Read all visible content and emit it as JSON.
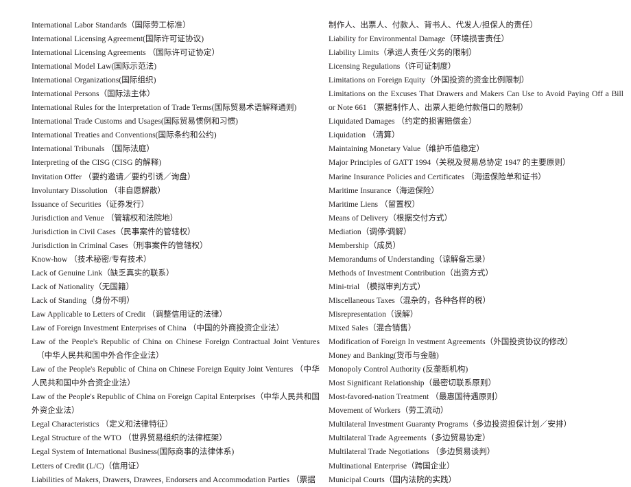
{
  "document": {
    "type": "bilingual-glossary-index",
    "page_background": "#ffffff",
    "text_color": "#231f20",
    "columns": 2
  },
  "left_column": {
    "entries": [
      {
        "id": "international-labor-standards",
        "text": "International Labor Standards（国际劳工标准）",
        "wrapped": false
      },
      {
        "id": "international-licensing-agreement",
        "text": "International Licensing Agreement(国际许可证协议)",
        "wrapped": false
      },
      {
        "id": "international-licensing-agreements",
        "text": "International Licensing Agreements  （国际许可证协定）",
        "wrapped": false
      },
      {
        "id": "international-model-law",
        "text": "International Model Law(国际示范法)",
        "wrapped": false
      },
      {
        "id": "international-organizations",
        "text": "International Organizations(国际组织)",
        "wrapped": false
      },
      {
        "id": "international-persons",
        "text": "International Persons（国际法主体）",
        "wrapped": false
      },
      {
        "id": "international-rules-interpretation-trade-terms",
        "text": "International Rules for the Interpretation of Trade Terms(国际贸易术语解释通则)",
        "wrapped": false
      },
      {
        "id": "international-trade-customs-and-usages",
        "text": "International Trade Customs and Usages(国际贸易惯例和习惯)",
        "wrapped": false
      },
      {
        "id": "international-treaties-and-conventions",
        "text": "International Treaties and Conventions(国际条约和公约)",
        "wrapped": false
      },
      {
        "id": "international-tribunals",
        "text": "International Tribunals  （国际法庭）",
        "wrapped": false
      },
      {
        "id": "interpreting-of-the-cisg",
        "text": "Interpreting of the CISG (CISG 的解释)",
        "wrapped": false
      },
      {
        "id": "invitation-offer",
        "text": "Invitation Offer  （要约邀请／要约引诱／询盘）",
        "wrapped": false
      },
      {
        "id": "involuntary-dissolution",
        "text": "Involuntary Dissolution  （非自愿解散）",
        "wrapped": false
      },
      {
        "id": "issuance-of-securities",
        "text": "Issuance of Securities（证券发行）",
        "wrapped": false
      },
      {
        "id": "jurisdiction-and-venue",
        "text": "Jurisdiction and Venue  （管辖权和法院地）",
        "wrapped": false
      },
      {
        "id": "jurisdiction-in-civil-cases",
        "text": "Jurisdiction in Civil Cases（民事案件的管辖权）",
        "wrapped": false
      },
      {
        "id": "jurisdiction-in-criminal-cases",
        "text": "Jurisdiction in Criminal Cases（刑事案件的管辖权）",
        "wrapped": false
      },
      {
        "id": "know-how",
        "text": "Know-how  （技术秘密/专有技术）",
        "wrapped": false
      },
      {
        "id": "lack-of-genuine-link",
        "text": "Lack of Genuine Link（缺乏真实的联系）",
        "wrapped": false
      },
      {
        "id": "lack-of-nationality",
        "text": "Lack of Nationality（无国籍）",
        "wrapped": false
      },
      {
        "id": "lack-of-standing",
        "text": "Lack of Standing（身份不明）",
        "wrapped": false
      },
      {
        "id": "law-applicable-to-letters-of-credit",
        "text": "Law Applicable to Letters of Credit  （调整信用证的法律）",
        "wrapped": false
      },
      {
        "id": "law-of-foreign-investment-enterprises-of-china",
        "text": "Law of Foreign Investment Enterprises of China  （中国的外商投资企业法）",
        "wrapped": false
      },
      {
        "id": "prc-chinese-foreign-contractual-joint-ventures",
        "text": "Law of the People's Republic of China on Chinese Foreign Contractual Joint Ventures （中华人民共和国中外合作企业法）",
        "wrapped": true,
        "hang": true
      },
      {
        "id": "prc-chinese-foreign-equity-joint-ventures",
        "text": "Law of the People's Republic of China on Chinese Foreign Equity Joint Ventures  （中华人民共和国中外合资企业法）",
        "wrapped": true,
        "hang": false
      },
      {
        "id": "prc-foreign-capital-enterprises",
        "text": "Law of the People's Republic of China on Foreign Capital Enterprises（中华人民共和国外资企业法）",
        "wrapped": true,
        "hang": false
      },
      {
        "id": "legal-characteristics",
        "text": "Legal Characteristics  （定义和法律特征）",
        "wrapped": false
      },
      {
        "id": "legal-structure-of-the-wto",
        "text": "Legal Structure of the WTO  （世界贸易组织的法律框架）",
        "wrapped": false
      },
      {
        "id": "legal-system-of-international-business",
        "text": "Legal System of International Business(国际商事的法律体系)",
        "wrapped": false
      },
      {
        "id": "letters-of-credit",
        "text": "Letters of Credit (L/C)（信用证）",
        "wrapped": false
      },
      {
        "id": "liabilities-of-makers-drawers-drawees",
        "text": "Liabilities of Makers, Drawers, Drawees, Endorsers and Accommodation Parties （票据",
        "wrapped": false,
        "continues_in_right_column": true
      }
    ]
  },
  "right_column": {
    "entries": [
      {
        "id": "liabilities-continuation",
        "text": "制作人、出票人、付款人、背书人、代发人/担保人的责任）",
        "is_continuation": true
      },
      {
        "id": "liability-for-environmental-damage",
        "text": "Liability for Environmental Damage（环境损害责任）",
        "wrapped": false
      },
      {
        "id": "liability-limits",
        "text": "Liability Limits（承运人责任/义务的限制）",
        "wrapped": false
      },
      {
        "id": "licensing-regulations",
        "text": "Licensing Regulations（许可证制度）",
        "wrapped": false
      },
      {
        "id": "limitations-on-foreign-equity",
        "text": "Limitations on Foreign Equity（外国投资的资金比例限制）",
        "wrapped": false
      },
      {
        "id": "limitations-on-the-excuses",
        "text": "Limitations on the Excuses That Drawers and Makers Can Use to Avoid Paying Off a Bill or Note  661  （票据制作人、出票人拒绝付款借口的限制）",
        "wrapped": true,
        "page_number": "661"
      },
      {
        "id": "liquidated-damages",
        "text": "Liquidated Damages  （约定的损害赔偿金）",
        "wrapped": false
      },
      {
        "id": "liquidation",
        "text": "Liquidation  （清算）",
        "wrapped": false
      },
      {
        "id": "maintaining-monetary-value",
        "text": "Maintaining Monetary Value（维护币值稳定）",
        "wrapped": false
      },
      {
        "id": "major-principles-of-gatt-1994",
        "text": "Major Principles of GATT 1994（关税及贸易总协定 1947 的主要原则）",
        "wrapped": false
      },
      {
        "id": "marine-insurance-policies-and-certificates",
        "text": "Marine Insurance Policies and Certificates  （海运保险单和证书）",
        "wrapped": false
      },
      {
        "id": "maritime-insurance",
        "text": "Maritime Insurance（海运保险）",
        "wrapped": false
      },
      {
        "id": "maritime-liens",
        "text": "Maritime Liens  （留置权）",
        "wrapped": false
      },
      {
        "id": "means-of-delivery",
        "text": "Means of Delivery（根据交付方式）",
        "wrapped": false
      },
      {
        "id": "mediation",
        "text": "Mediation（调停/调解）",
        "wrapped": false
      },
      {
        "id": "membership",
        "text": "Membership（成员）",
        "wrapped": false
      },
      {
        "id": "memorandums-of-understanding",
        "text": "Memorandums of Understanding（谅解备忘录）",
        "wrapped": false
      },
      {
        "id": "methods-of-investment-contribution",
        "text": "Methods of Investment Contribution（出资方式）",
        "wrapped": false
      },
      {
        "id": "mini-trial",
        "text": "Mini-trial  （模拟审判方式）",
        "wrapped": false
      },
      {
        "id": "miscellaneous-taxes",
        "text": "Miscellaneous Taxes（混杂的，各种各样的税）",
        "wrapped": false
      },
      {
        "id": "misrepresentation",
        "text": "Misrepresentation（误解）",
        "wrapped": false
      },
      {
        "id": "mixed-sales",
        "text": "Mixed Sales（混合销售）",
        "wrapped": false
      },
      {
        "id": "modification-of-foreign-investment-agreements",
        "text": "Modification of Foreign In vestment Agreements（外国投资协议的修改）",
        "wrapped": false
      },
      {
        "id": "money-and-banking",
        "text": "Money and Banking(货币与金融)",
        "wrapped": false
      },
      {
        "id": "monopoly-control-authority",
        "text": "Monopoly Control Authority (反垄断机构)",
        "wrapped": false
      },
      {
        "id": "most-significant-relationship",
        "text": "Most Significant Relationship（最密切联系原则）",
        "wrapped": false
      },
      {
        "id": "most-favored-nation-treatment",
        "text": "Most-favored-nation Treatment  （最惠国待遇原则）",
        "wrapped": false
      },
      {
        "id": "movement-of-workers",
        "text": "Movement of Workers（劳工流动）",
        "wrapped": false
      },
      {
        "id": "multilateral-investment-guaranty-programs",
        "text": "Multilateral Investment Guaranty Programs（多边投资担保计划／安排）",
        "wrapped": false
      },
      {
        "id": "multilateral-trade-agreements",
        "text": "Multilateral Trade Agreements（多边贸易协定）",
        "wrapped": false
      },
      {
        "id": "multilateral-trade-negotiations",
        "text": "Multilateral Trade Negotiations  （多边贸易谈判）",
        "wrapped": false
      },
      {
        "id": "multinational-enterprise",
        "text": "Multinational Enterprise（跨国企业）",
        "wrapped": false
      },
      {
        "id": "municipal-courts",
        "text": "Municipal Courts（国内法院的实践）",
        "wrapped": false
      }
    ]
  }
}
